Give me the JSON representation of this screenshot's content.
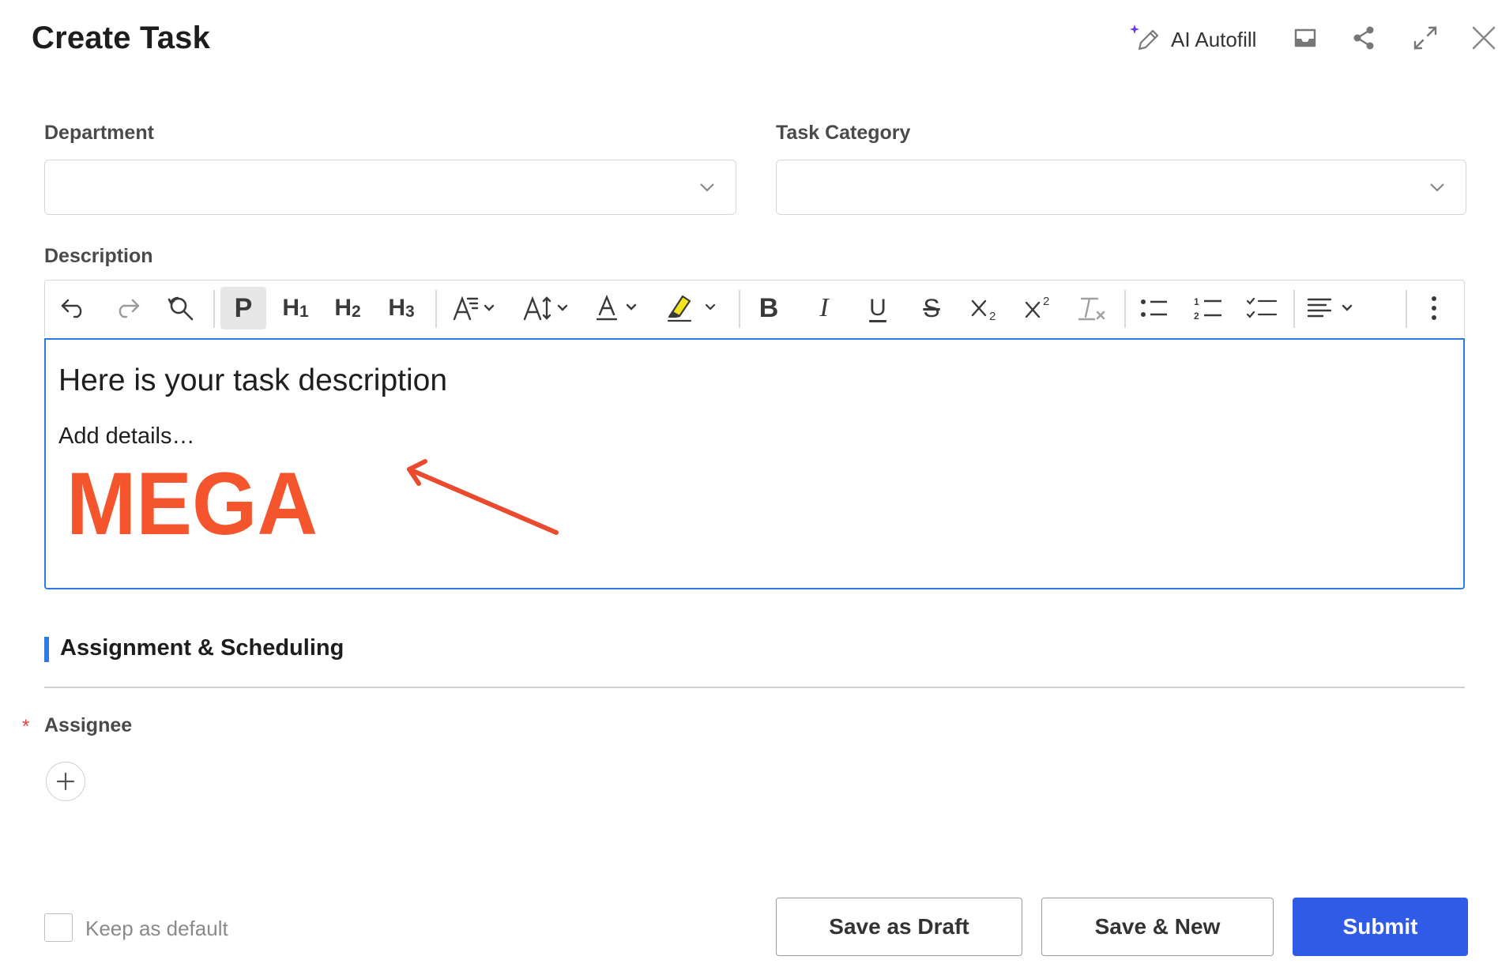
{
  "header": {
    "title": "Create Task",
    "ai_autofill_label": "AI Autofill",
    "icons": [
      "sparkle-pencil-icon",
      "inbox-icon",
      "share-icon",
      "expand-icon",
      "close-icon"
    ]
  },
  "form": {
    "department": {
      "label": "Department",
      "value": ""
    },
    "task_category": {
      "label": "Task Category",
      "value": ""
    },
    "description": {
      "label": "Description",
      "toolbar": {
        "paragraph": "P",
        "h1": "H",
        "h1_sub": "1",
        "h2": "H",
        "h2_sub": "2",
        "h3": "H",
        "h3_sub": "3",
        "bold": "B",
        "italic": "I",
        "underline": "U",
        "strike": "S"
      },
      "content": {
        "heading": "Here is your task description",
        "paragraph": "Add details…",
        "logo_text": "MEGA"
      }
    }
  },
  "section": {
    "title": "Assignment & Scheduling",
    "assignee_label": "Assignee",
    "required_marker": "*"
  },
  "footer": {
    "keep_default_label": "Keep as default",
    "keep_default_checked": false,
    "save_draft_label": "Save as Draft",
    "save_new_label": "Save & New",
    "submit_label": "Submit"
  },
  "colors": {
    "accent": "#2d7be5",
    "primary_button": "#2f5be6",
    "logo": "#f4552c",
    "annotation_arrow": "#ea4b2e",
    "required": "#e0413a",
    "ai_sparkle": "#6b35e8"
  }
}
